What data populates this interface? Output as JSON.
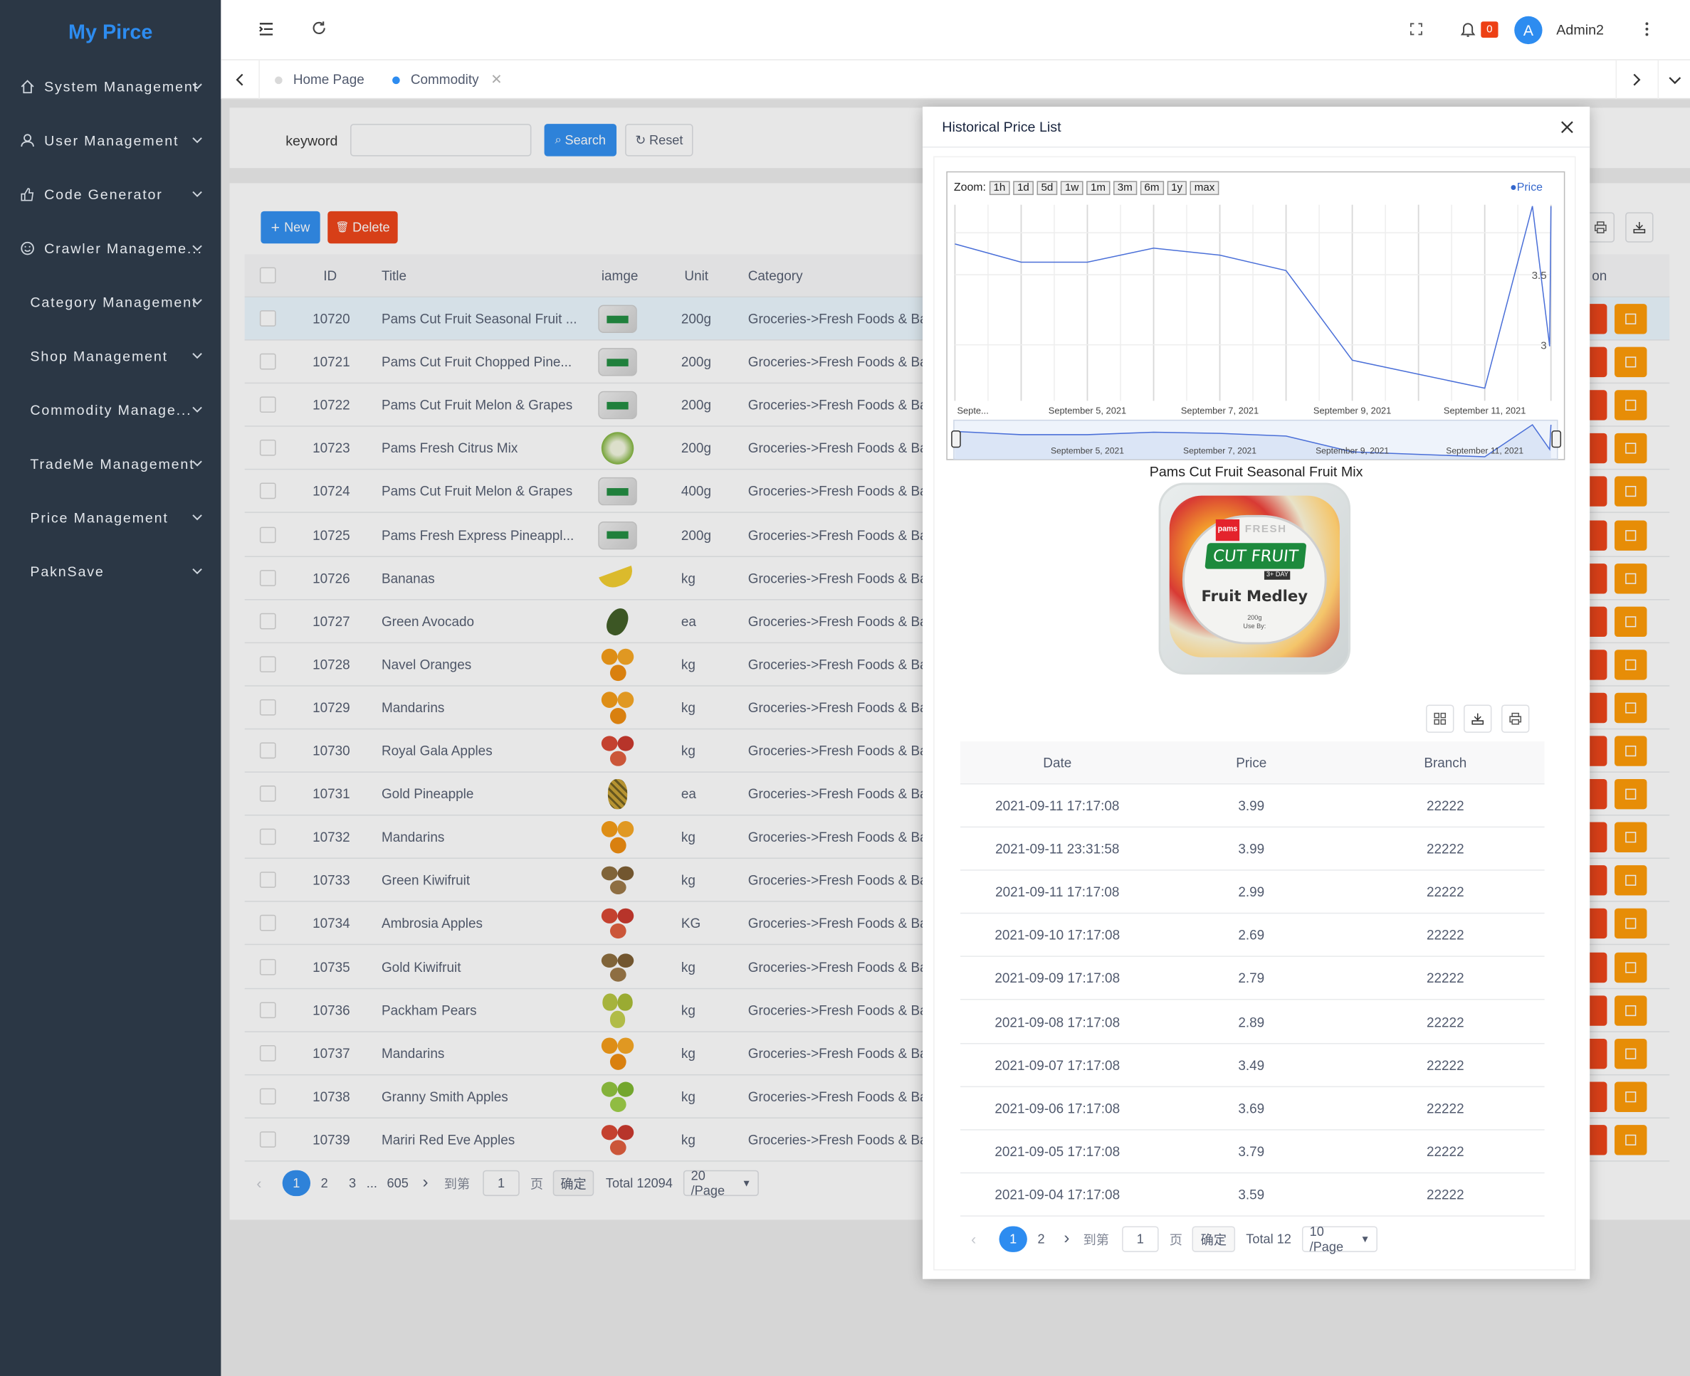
{
  "app": {
    "logo": "My Pirce"
  },
  "sidebar": {
    "items": [
      {
        "label": "System Management",
        "icon": "home-icon"
      },
      {
        "label": "User Management",
        "icon": "user-icon"
      },
      {
        "label": "Code Generator",
        "icon": "thumbs-up-icon"
      },
      {
        "label": "Crawler Manageme...",
        "icon": "smile-icon"
      },
      {
        "label": "Category Management",
        "icon": ""
      },
      {
        "label": "Shop Management",
        "icon": ""
      },
      {
        "label": "Commodity Manage...",
        "icon": ""
      },
      {
        "label": "TradeMe Management",
        "icon": ""
      },
      {
        "label": "Price Management",
        "icon": ""
      },
      {
        "label": "PaknSave",
        "icon": ""
      }
    ]
  },
  "header": {
    "notification_count": "0",
    "avatar_letter": "A",
    "username": "Admin2"
  },
  "tabs": [
    {
      "label": "Home Page"
    },
    {
      "label": "Commodity"
    }
  ],
  "search": {
    "keyword_label": "keyword",
    "keyword_value": "",
    "search_label": "Search",
    "reset_label": "Reset"
  },
  "toolbar": {
    "new_label": "New",
    "delete_label": "Delete"
  },
  "table": {
    "headers": {
      "id": "ID",
      "title": "Title",
      "image": "iamge",
      "unit": "Unit",
      "category": "Category",
      "action": "on"
    },
    "rows": [
      {
        "id": "10720",
        "title": "Pams Cut Fruit Seasonal Fruit ...",
        "unit": "200g",
        "category": "Groceries->Fresh Foods & Ba..."
      },
      {
        "id": "10721",
        "title": "Pams Cut Fruit Chopped Pine...",
        "unit": "200g",
        "category": "Groceries->Fresh Foods & Ba..."
      },
      {
        "id": "10722",
        "title": "Pams Cut Fruit Melon & Grapes",
        "unit": "200g",
        "category": "Groceries->Fresh Foods & Ba..."
      },
      {
        "id": "10723",
        "title": "Pams Fresh Citrus Mix",
        "unit": "200g",
        "category": "Groceries->Fresh Foods & Ba..."
      },
      {
        "id": "10724",
        "title": "Pams Cut Fruit Melon & Grapes",
        "unit": "400g",
        "category": "Groceries->Fresh Foods & Ba..."
      },
      {
        "id": "10725",
        "title": "Pams Fresh Express Pineappl...",
        "unit": "200g",
        "category": "Groceries->Fresh Foods & Ba..."
      },
      {
        "id": "10726",
        "title": "Bananas",
        "unit": "kg",
        "category": "Groceries->Fresh Foods & Ba..."
      },
      {
        "id": "10727",
        "title": "Green Avocado",
        "unit": "ea",
        "category": "Groceries->Fresh Foods & Ba..."
      },
      {
        "id": "10728",
        "title": "Navel Oranges",
        "unit": "kg",
        "category": "Groceries->Fresh Foods & Ba..."
      },
      {
        "id": "10729",
        "title": "Mandarins",
        "unit": "kg",
        "category": "Groceries->Fresh Foods & Ba..."
      },
      {
        "id": "10730",
        "title": "Royal Gala Apples",
        "unit": "kg",
        "category": "Groceries->Fresh Foods & Ba..."
      },
      {
        "id": "10731",
        "title": "Gold Pineapple",
        "unit": "ea",
        "category": "Groceries->Fresh Foods & Ba..."
      },
      {
        "id": "10732",
        "title": "Mandarins",
        "unit": "kg",
        "category": "Groceries->Fresh Foods & Ba..."
      },
      {
        "id": "10733",
        "title": "Green Kiwifruit",
        "unit": "kg",
        "category": "Groceries->Fresh Foods & Ba..."
      },
      {
        "id": "10734",
        "title": "Ambrosia Apples",
        "unit": "KG",
        "category": "Groceries->Fresh Foods & Ba..."
      },
      {
        "id": "10735",
        "title": "Gold Kiwifruit",
        "unit": "kg",
        "category": "Groceries->Fresh Foods & Ba..."
      },
      {
        "id": "10736",
        "title": "Packham Pears",
        "unit": "kg",
        "category": "Groceries->Fresh Foods & Ba..."
      },
      {
        "id": "10737",
        "title": "Mandarins",
        "unit": "kg",
        "category": "Groceries->Fresh Foods & Ba..."
      },
      {
        "id": "10738",
        "title": "Granny Smith Apples",
        "unit": "kg",
        "category": "Groceries->Fresh Foods & Ba..."
      },
      {
        "id": "10739",
        "title": "Mariri Red Eve Apples",
        "unit": "kg",
        "category": "Groceries->Fresh Foods & Ba..."
      }
    ]
  },
  "pagination": {
    "pages": [
      "1",
      "2",
      "3",
      "...",
      "605"
    ],
    "goto_label": "到第",
    "goto_value": "1",
    "page_suffix": "页",
    "confirm_label": "确定",
    "total": "Total 12094",
    "page_size": "20 /Page"
  },
  "modal": {
    "title": "Historical Price List",
    "product_name": "Pams Cut Fruit Seasonal Fruit Mix",
    "product_image": {
      "brand": "pams",
      "line1": "FRESH",
      "line2": "CUT FRUIT",
      "line3": "Fruit Medley",
      "weight": "200g",
      "note": "Use By:",
      "badge": "3+ DAY"
    },
    "zoom_label": "Zoom:",
    "zoom_options": [
      "1h",
      "1d",
      "5d",
      "1w",
      "1m",
      "3m",
      "6m",
      "1y",
      "max"
    ],
    "table": {
      "headers": {
        "date": "Date",
        "price": "Price",
        "branch": "Branch"
      },
      "rows": [
        {
          "date": "2021-09-11 17:17:08",
          "price": "3.99",
          "branch": "22222"
        },
        {
          "date": "2021-09-11 23:31:58",
          "price": "3.99",
          "branch": "22222"
        },
        {
          "date": "2021-09-11 17:17:08",
          "price": "2.99",
          "branch": "22222"
        },
        {
          "date": "2021-09-10 17:17:08",
          "price": "2.69",
          "branch": "22222"
        },
        {
          "date": "2021-09-09 17:17:08",
          "price": "2.79",
          "branch": "22222"
        },
        {
          "date": "2021-09-08 17:17:08",
          "price": "2.89",
          "branch": "22222"
        },
        {
          "date": "2021-09-07 17:17:08",
          "price": "3.49",
          "branch": "22222"
        },
        {
          "date": "2021-09-06 17:17:08",
          "price": "3.69",
          "branch": "22222"
        },
        {
          "date": "2021-09-05 17:17:08",
          "price": "3.79",
          "branch": "22222"
        },
        {
          "date": "2021-09-04 17:17:08",
          "price": "3.59",
          "branch": "22222"
        }
      ]
    },
    "pagination": {
      "pages": [
        "1",
        "2"
      ],
      "goto_label": "到第",
      "goto_value": "1",
      "page_suffix": "页",
      "confirm_label": "确定",
      "total": "Total 12",
      "page_size": "10 /Page"
    }
  },
  "chart_data": {
    "type": "line",
    "legend": [
      "Price"
    ],
    "legend_position": "top-right",
    "series": [
      {
        "name": "Price",
        "points": [
          {
            "x": "2021-09-03",
            "y": 3.72
          },
          {
            "x": "2021-09-04",
            "y": 3.59
          },
          {
            "x": "2021-09-05",
            "y": 3.59
          },
          {
            "x": "2021-09-06",
            "y": 3.69
          },
          {
            "x": "2021-09-07",
            "y": 3.64
          },
          {
            "x": "2021-09-08",
            "y": 3.53
          },
          {
            "x": "2021-09-09",
            "y": 2.89
          },
          {
            "x": "2021-09-10",
            "y": 2.79
          },
          {
            "x": "2021-09-11 00:00",
            "y": 2.69
          },
          {
            "x": "2021-09-11 17:17",
            "y": 3.99
          },
          {
            "x": "2021-09-11 23:31",
            "y": 2.99
          },
          {
            "x": "2021-09-12",
            "y": 3.99
          }
        ]
      }
    ],
    "x_tick_labels": [
      "Septe...",
      "September 5, 2021",
      "September 7, 2021",
      "September 9, 2021",
      "September 11, 2021"
    ],
    "navigator_tick_labels": [
      "September 5, 2021",
      "September 7, 2021",
      "September 9, 2021",
      "September 11, 2021"
    ],
    "y_tick_labels": [
      "3.5",
      "3"
    ],
    "ylim": [
      2.6,
      4.0
    ],
    "grid": true
  },
  "colors": {
    "sidebar": "#2b3745",
    "primary": "#2d8cf0",
    "danger": "#ed4014",
    "warning": "#ff9900",
    "chart_line": "#4a6fd8"
  }
}
